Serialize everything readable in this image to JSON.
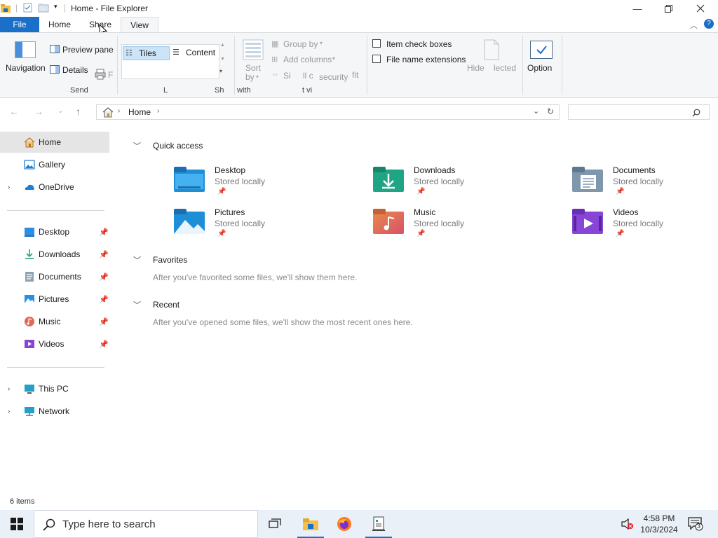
{
  "window": {
    "title": "Home - File Explorer"
  },
  "ribbon_tabs": [
    {
      "label": "File"
    },
    {
      "label": "Home"
    },
    {
      "label": "Share"
    },
    {
      "label": "View"
    }
  ],
  "ribbon": {
    "navigation_pane": "Navigation",
    "preview_pane": "Preview pane",
    "details_pane": "Details",
    "send_group": "Send",
    "layout_tiles": "Tiles",
    "layout_content": "Content",
    "layout_group": "L",
    "show_group_frag": "Sh",
    "sort_by": "Sort",
    "sort_by2": "by",
    "group_by": "Group by",
    "add_columns": "Add columns",
    "size_all": "Si",
    "size_all2": "ll c",
    "security": "security",
    "fit": "fit",
    "with_frag": "with",
    "view_frag": "t vi",
    "item_check_boxes": "Item check boxes",
    "file_name_extensions": "File name extensions",
    "hide_selected": "Hide",
    "hide_selected2": "lected",
    "options": "Option"
  },
  "address": {
    "crumb": "Home"
  },
  "nav": {
    "home": "Home",
    "gallery": "Gallery",
    "onedrive": "OneDrive",
    "pinned": [
      {
        "label": "Desktop"
      },
      {
        "label": "Downloads"
      },
      {
        "label": "Documents"
      },
      {
        "label": "Pictures"
      },
      {
        "label": "Music"
      },
      {
        "label": "Videos"
      }
    ],
    "this_pc": "This PC",
    "network": "Network"
  },
  "sections": {
    "quick_access": "Quick access",
    "favorites": "Favorites",
    "favorites_empty": "After you've favorited some files, we'll show them here.",
    "recent": "Recent",
    "recent_empty": "After you've opened some files, we'll show the most recent ones here."
  },
  "quick_access": [
    {
      "name": "Desktop",
      "status": "Stored locally",
      "icon": "desktop-folder-icon",
      "color": "#1e8fd6"
    },
    {
      "name": "Downloads",
      "status": "Stored locally",
      "icon": "downloads-folder-icon",
      "color": "#1fa583"
    },
    {
      "name": "Documents",
      "status": "Stored locally",
      "icon": "documents-folder-icon",
      "color": "#7f97ad"
    },
    {
      "name": "Pictures",
      "status": "Stored locally",
      "icon": "pictures-folder-icon",
      "color": "#1e8fd6"
    },
    {
      "name": "Music",
      "status": "Stored locally",
      "icon": "music-folder-icon",
      "color": "#e0744f"
    },
    {
      "name": "Videos",
      "status": "Stored locally",
      "icon": "videos-folder-icon",
      "color": "#8746d6"
    }
  ],
  "status": {
    "items": "6 items"
  },
  "taskbar": {
    "search_placeholder": "Type here to search",
    "time": "4:58 PM",
    "date": "10/3/2024",
    "notification_count": "3"
  },
  "colors": {
    "accent": "#1a6fc9",
    "nav_selected": "#e5e5e5",
    "taskbar": "#eaf0f7"
  }
}
